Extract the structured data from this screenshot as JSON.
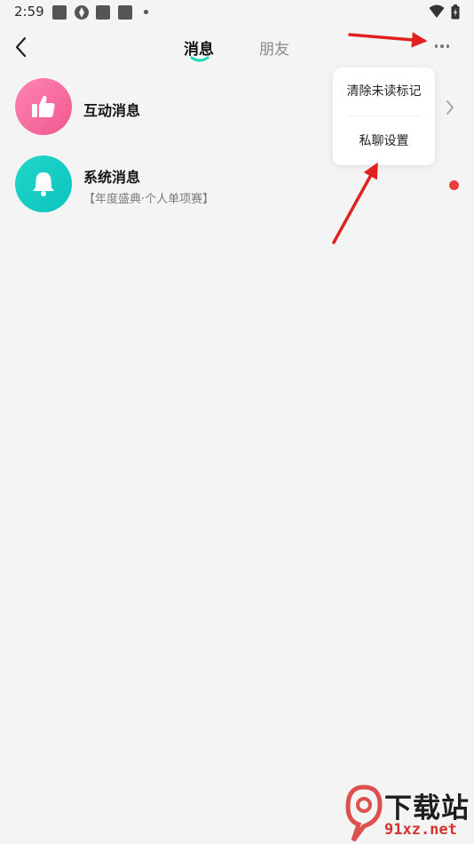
{
  "status_bar": {
    "time": "2:59"
  },
  "header": {
    "tabs": [
      {
        "label": "消息",
        "active": true
      },
      {
        "label": "朋友",
        "active": false
      }
    ]
  },
  "list": {
    "items": [
      {
        "title": "互动消息",
        "subtitle": "",
        "avatar_icon": "thumbs-up-icon",
        "avatar_color": "#f4649b"
      },
      {
        "title": "系统消息",
        "subtitle": "【年度盛典·个人单项赛】",
        "avatar_icon": "bell-icon",
        "avatar_color": "#14ccc4",
        "unread": true
      }
    ]
  },
  "popup_menu": {
    "items": [
      {
        "label": "清除未读标记"
      },
      {
        "label": "私聊设置"
      }
    ]
  },
  "watermark": {
    "text": "下载站",
    "url": "91xz.net"
  },
  "colors": {
    "background": "#f4f4f4",
    "accent_underline": "#1ed8b4",
    "unread_dot": "#ee3f3f",
    "arrow": "#e0211d"
  }
}
